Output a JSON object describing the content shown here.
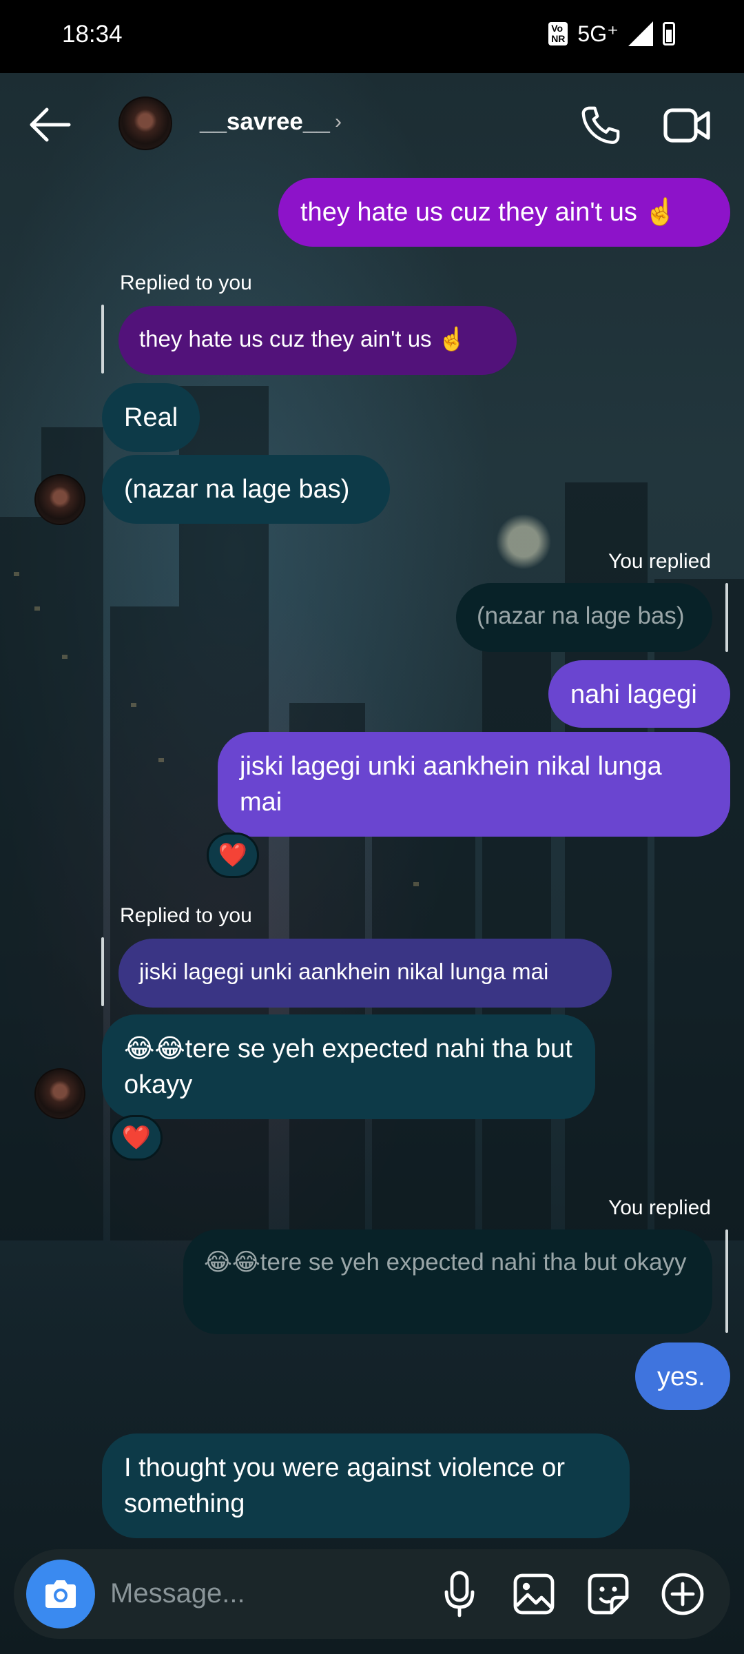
{
  "status_bar": {
    "time": "18:34",
    "volte": "Vo\nNR",
    "network": "5G⁺"
  },
  "header": {
    "username": "__savree__"
  },
  "thread": {
    "m1": "they hate us cuz they ain't us ☝️",
    "label1": "Replied to you",
    "quote1": "they hate us cuz they ain't us ☝️",
    "m2": "Real",
    "m3": "(nazar na lage bas)",
    "label2": "You replied",
    "quote2": "(nazar na lage bas)",
    "m4": "nahi lagegi",
    "m5": "jiski lagegi unki aankhein nikal lunga mai",
    "reaction1": "❤️",
    "label3": "Replied to you",
    "quote3": "jiski lagegi unki aankhein nikal lunga mai",
    "m6": "😂😂tere se yeh expected nahi tha but okayy",
    "reaction2": "❤️",
    "label4": "You replied",
    "quote4": "😂😂tere se yeh expected nahi tha but okayy",
    "m7": "yes.",
    "m8": "I thought you were against violence or something"
  },
  "composer": {
    "placeholder": "Message..."
  },
  "colors": {
    "purple": "#8d13c9",
    "violet": "#6a45d0",
    "blue": "#3f74de",
    "teal": "#0d3a48",
    "camera": "#3a8af0"
  },
  "icons": [
    "back-arrow-icon",
    "chevron-right-icon",
    "phone-icon",
    "video-icon",
    "camera-icon",
    "mic-icon",
    "gallery-icon",
    "sticker-icon",
    "plus-icon",
    "heart-icon"
  ]
}
